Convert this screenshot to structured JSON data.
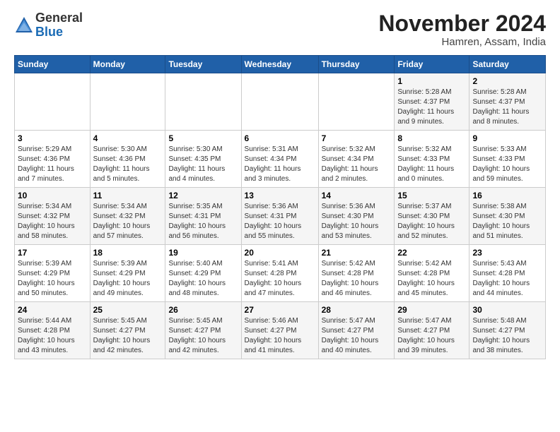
{
  "logo": {
    "general": "General",
    "blue": "Blue"
  },
  "header": {
    "month": "November 2024",
    "location": "Hamren, Assam, India"
  },
  "weekdays": [
    "Sunday",
    "Monday",
    "Tuesday",
    "Wednesday",
    "Thursday",
    "Friday",
    "Saturday"
  ],
  "weeks": [
    [
      {
        "day": "",
        "info": ""
      },
      {
        "day": "",
        "info": ""
      },
      {
        "day": "",
        "info": ""
      },
      {
        "day": "",
        "info": ""
      },
      {
        "day": "",
        "info": ""
      },
      {
        "day": "1",
        "info": "Sunrise: 5:28 AM\nSunset: 4:37 PM\nDaylight: 11 hours\nand 9 minutes."
      },
      {
        "day": "2",
        "info": "Sunrise: 5:28 AM\nSunset: 4:37 PM\nDaylight: 11 hours\nand 8 minutes."
      }
    ],
    [
      {
        "day": "3",
        "info": "Sunrise: 5:29 AM\nSunset: 4:36 PM\nDaylight: 11 hours\nand 7 minutes."
      },
      {
        "day": "4",
        "info": "Sunrise: 5:30 AM\nSunset: 4:36 PM\nDaylight: 11 hours\nand 5 minutes."
      },
      {
        "day": "5",
        "info": "Sunrise: 5:30 AM\nSunset: 4:35 PM\nDaylight: 11 hours\nand 4 minutes."
      },
      {
        "day": "6",
        "info": "Sunrise: 5:31 AM\nSunset: 4:34 PM\nDaylight: 11 hours\nand 3 minutes."
      },
      {
        "day": "7",
        "info": "Sunrise: 5:32 AM\nSunset: 4:34 PM\nDaylight: 11 hours\nand 2 minutes."
      },
      {
        "day": "8",
        "info": "Sunrise: 5:32 AM\nSunset: 4:33 PM\nDaylight: 11 hours\nand 0 minutes."
      },
      {
        "day": "9",
        "info": "Sunrise: 5:33 AM\nSunset: 4:33 PM\nDaylight: 10 hours\nand 59 minutes."
      }
    ],
    [
      {
        "day": "10",
        "info": "Sunrise: 5:34 AM\nSunset: 4:32 PM\nDaylight: 10 hours\nand 58 minutes."
      },
      {
        "day": "11",
        "info": "Sunrise: 5:34 AM\nSunset: 4:32 PM\nDaylight: 10 hours\nand 57 minutes."
      },
      {
        "day": "12",
        "info": "Sunrise: 5:35 AM\nSunset: 4:31 PM\nDaylight: 10 hours\nand 56 minutes."
      },
      {
        "day": "13",
        "info": "Sunrise: 5:36 AM\nSunset: 4:31 PM\nDaylight: 10 hours\nand 55 minutes."
      },
      {
        "day": "14",
        "info": "Sunrise: 5:36 AM\nSunset: 4:30 PM\nDaylight: 10 hours\nand 53 minutes."
      },
      {
        "day": "15",
        "info": "Sunrise: 5:37 AM\nSunset: 4:30 PM\nDaylight: 10 hours\nand 52 minutes."
      },
      {
        "day": "16",
        "info": "Sunrise: 5:38 AM\nSunset: 4:30 PM\nDaylight: 10 hours\nand 51 minutes."
      }
    ],
    [
      {
        "day": "17",
        "info": "Sunrise: 5:39 AM\nSunset: 4:29 PM\nDaylight: 10 hours\nand 50 minutes."
      },
      {
        "day": "18",
        "info": "Sunrise: 5:39 AM\nSunset: 4:29 PM\nDaylight: 10 hours\nand 49 minutes."
      },
      {
        "day": "19",
        "info": "Sunrise: 5:40 AM\nSunset: 4:29 PM\nDaylight: 10 hours\nand 48 minutes."
      },
      {
        "day": "20",
        "info": "Sunrise: 5:41 AM\nSunset: 4:28 PM\nDaylight: 10 hours\nand 47 minutes."
      },
      {
        "day": "21",
        "info": "Sunrise: 5:42 AM\nSunset: 4:28 PM\nDaylight: 10 hours\nand 46 minutes."
      },
      {
        "day": "22",
        "info": "Sunrise: 5:42 AM\nSunset: 4:28 PM\nDaylight: 10 hours\nand 45 minutes."
      },
      {
        "day": "23",
        "info": "Sunrise: 5:43 AM\nSunset: 4:28 PM\nDaylight: 10 hours\nand 44 minutes."
      }
    ],
    [
      {
        "day": "24",
        "info": "Sunrise: 5:44 AM\nSunset: 4:28 PM\nDaylight: 10 hours\nand 43 minutes."
      },
      {
        "day": "25",
        "info": "Sunrise: 5:45 AM\nSunset: 4:27 PM\nDaylight: 10 hours\nand 42 minutes."
      },
      {
        "day": "26",
        "info": "Sunrise: 5:45 AM\nSunset: 4:27 PM\nDaylight: 10 hours\nand 42 minutes."
      },
      {
        "day": "27",
        "info": "Sunrise: 5:46 AM\nSunset: 4:27 PM\nDaylight: 10 hours\nand 41 minutes."
      },
      {
        "day": "28",
        "info": "Sunrise: 5:47 AM\nSunset: 4:27 PM\nDaylight: 10 hours\nand 40 minutes."
      },
      {
        "day": "29",
        "info": "Sunrise: 5:47 AM\nSunset: 4:27 PM\nDaylight: 10 hours\nand 39 minutes."
      },
      {
        "day": "30",
        "info": "Sunrise: 5:48 AM\nSunset: 4:27 PM\nDaylight: 10 hours\nand 38 minutes."
      }
    ]
  ]
}
